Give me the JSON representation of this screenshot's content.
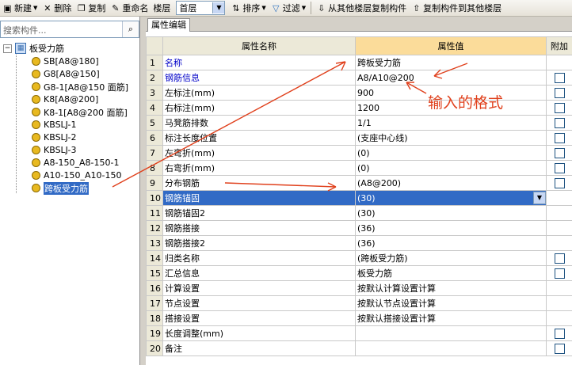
{
  "toolbar": {
    "new_label": "新建",
    "delete_label": "删除",
    "copy_label": "复制",
    "rename_label": "重命名",
    "floor_label": "楼层",
    "floor_value": "首层",
    "sort_label": "排序",
    "filter_label": "过滤",
    "copy_from_label": "从其他楼层复制构件",
    "copy_to_label": "复制构件到其他楼层"
  },
  "left_panel": {
    "search_placeholder": "搜索构件...",
    "root_label": "板受力筋",
    "items": [
      "SB[A8@180]",
      "G8[A8@150]",
      "G8-1[A8@150 面筋]",
      "K8[A8@200]",
      "K8-1[A8@200 面筋]",
      "KBSLJ-1",
      "KBSLJ-2",
      "KBSLJ-3",
      "A8-150_A8-150-1",
      "A10-150_A10-150",
      "跨板受力筋"
    ],
    "selected_item": "跨板受力筋"
  },
  "property_panel": {
    "tab_label": "属性编辑",
    "columns": {
      "name": "属性名称",
      "value": "属性值",
      "extra": "附加"
    },
    "rows": [
      {
        "num": "1",
        "name": "名称",
        "value": "跨板受力筋",
        "blue": true,
        "checkbox": false
      },
      {
        "num": "2",
        "name": "钢筋信息",
        "value": "A8/A10@200",
        "blue": true,
        "checkbox": true
      },
      {
        "num": "3",
        "name": "左标注(mm)",
        "value": "900",
        "blue": false,
        "checkbox": true
      },
      {
        "num": "4",
        "name": "右标注(mm)",
        "value": "1200",
        "blue": false,
        "checkbox": true
      },
      {
        "num": "5",
        "name": "马凳筋排数",
        "value": "1/1",
        "blue": false,
        "checkbox": true
      },
      {
        "num": "6",
        "name": "标注长度位置",
        "value": "(支座中心线)",
        "blue": false,
        "checkbox": true
      },
      {
        "num": "7",
        "name": "左弯折(mm)",
        "value": "(0)",
        "blue": false,
        "checkbox": true
      },
      {
        "num": "8",
        "name": "右弯折(mm)",
        "value": "(0)",
        "blue": false,
        "checkbox": true
      },
      {
        "num": "9",
        "name": "分布钢筋",
        "value": "(A8@200)",
        "blue": false,
        "checkbox": true
      },
      {
        "num": "10",
        "name": "钢筋锚固",
        "value": "(30)",
        "blue": false,
        "checkbox": false,
        "selected": true
      },
      {
        "num": "11",
        "name": "钢筋锚固2",
        "value": "(30)",
        "blue": false,
        "checkbox": false
      },
      {
        "num": "12",
        "name": "钢筋搭接",
        "value": "(36)",
        "blue": false,
        "checkbox": false
      },
      {
        "num": "13",
        "name": "钢筋搭接2",
        "value": "(36)",
        "blue": false,
        "checkbox": false
      },
      {
        "num": "14",
        "name": "归类名称",
        "value": "(跨板受力筋)",
        "blue": false,
        "checkbox": true
      },
      {
        "num": "15",
        "name": "汇总信息",
        "value": "板受力筋",
        "blue": false,
        "checkbox": true
      },
      {
        "num": "16",
        "name": "计算设置",
        "value": "按默认计算设置计算",
        "blue": false,
        "checkbox": false
      },
      {
        "num": "17",
        "name": "节点设置",
        "value": "按默认节点设置计算",
        "blue": false,
        "checkbox": false
      },
      {
        "num": "18",
        "name": "搭接设置",
        "value": "按默认搭接设置计算",
        "blue": false,
        "checkbox": false
      },
      {
        "num": "19",
        "name": "长度调整(mm)",
        "value": "",
        "blue": false,
        "checkbox": true
      },
      {
        "num": "20",
        "name": "备注",
        "value": "",
        "blue": false,
        "checkbox": true
      }
    ]
  },
  "annotation": {
    "text": "输入的格式",
    "color": "#e0401c"
  }
}
